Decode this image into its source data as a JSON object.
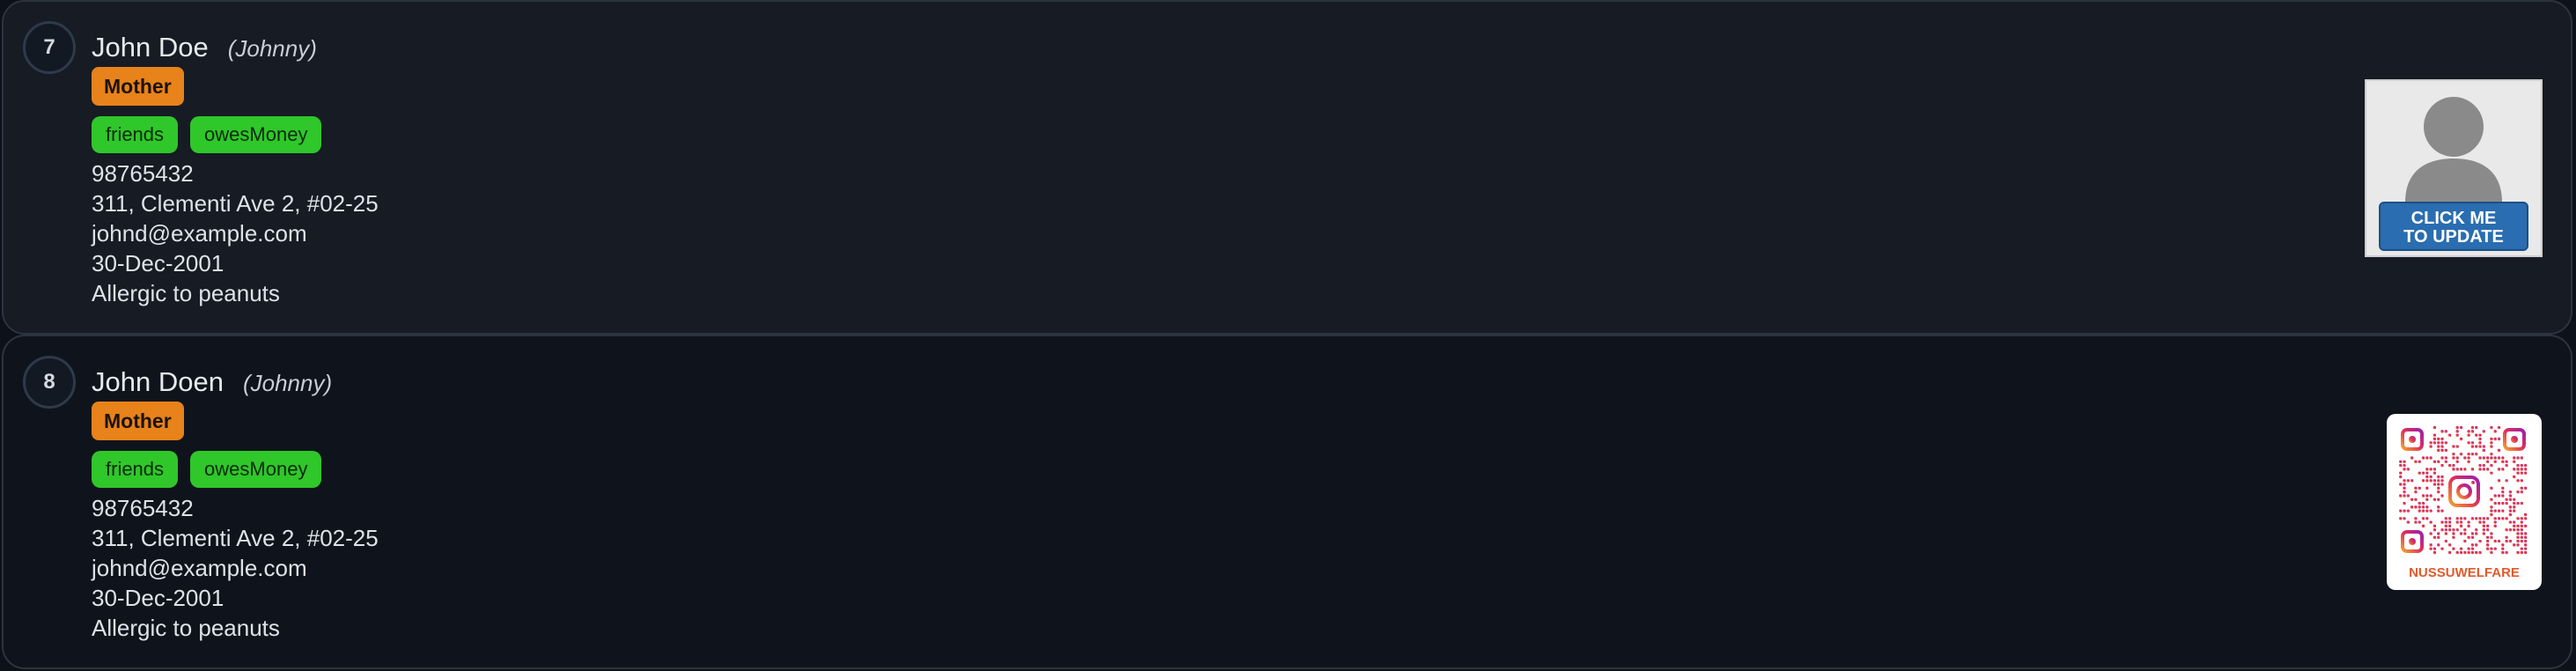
{
  "contacts": [
    {
      "index": "7",
      "name": "John Doe",
      "nickname": "(Johnny)",
      "relationship": "Mother",
      "tags": [
        "friends",
        "owesMoney"
      ],
      "phone": "98765432",
      "address": "311, Clementi Ave 2, #02-25",
      "email": "johnd@example.com",
      "birthday": "30-Dec-2001",
      "note": "Allergic to peanuts",
      "photo_button_line1": "CLICK ME",
      "photo_button_line2": "TO UPDATE"
    },
    {
      "index": "8",
      "name": "John Doen",
      "nickname": "(Johnny)",
      "relationship": "Mother",
      "tags": [
        "friends",
        "owesMoney"
      ],
      "phone": "98765432",
      "address": "311, Clementi Ave 2, #02-25",
      "email": "johnd@example.com",
      "birthday": "30-Dec-2001",
      "note": "Allergic to peanuts",
      "qr_caption": "NUSSUWELFARE"
    }
  ],
  "colors": {
    "relationship_badge": "#e8821a",
    "tag": "#2fc72a",
    "photo_button": "#2a6db0",
    "qr_gradient_start": "#f0a030",
    "qr_gradient_end": "#9d1fb0"
  },
  "icons": {
    "avatar": "person-silhouette-icon",
    "qr": "instagram-qr-code-icon"
  }
}
